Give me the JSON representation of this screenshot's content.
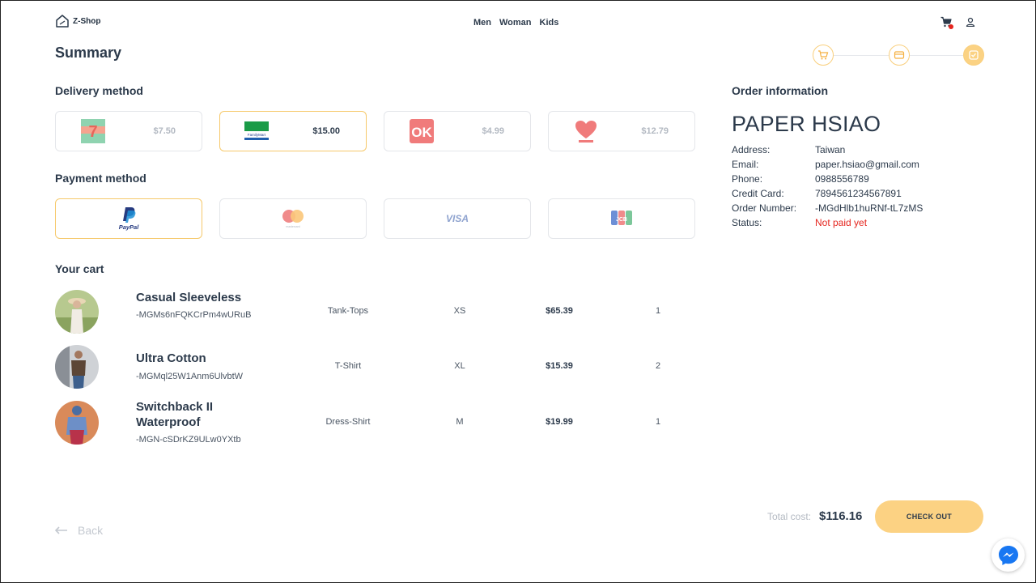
{
  "header": {
    "logo_text": "Z-Shop",
    "nav": [
      "Men",
      "Woman",
      "Kids"
    ]
  },
  "page_title": "Summary",
  "delivery": {
    "title": "Delivery method",
    "options": [
      {
        "name": "7-Eleven",
        "price": "$7.50",
        "selected": false
      },
      {
        "name": "FamilyMart",
        "price": "$15.00",
        "selected": true
      },
      {
        "name": "OK",
        "price": "$4.99",
        "selected": false
      },
      {
        "name": "Hi-Life",
        "price": "$12.79",
        "selected": false
      }
    ]
  },
  "payment": {
    "title": "Payment method",
    "options": [
      {
        "name": "PayPal",
        "selected": true
      },
      {
        "name": "mastercard",
        "selected": false
      },
      {
        "name": "VISA",
        "selected": false
      },
      {
        "name": "JCB",
        "selected": false
      }
    ]
  },
  "cart": {
    "title": "Your cart",
    "items": [
      {
        "name": "Casual Sleeveless",
        "id": "-MGMs6nFQKCrPm4wURuB",
        "category": "Tank-Tops",
        "size": "XS",
        "price": "$65.39",
        "qty": "1"
      },
      {
        "name": "Ultra Cotton",
        "id": "-MGMql25W1Anm6UlvbtW",
        "category": "T-Shirt",
        "size": "XL",
        "price": "$15.39",
        "qty": "2"
      },
      {
        "name": "Switchback II Waterproof",
        "id": "-MGN-cSDrKZ9ULw0YXtb",
        "category": "Dress-Shirt",
        "size": "M",
        "price": "$19.99",
        "qty": "1"
      }
    ]
  },
  "order_info": {
    "title": "Order information",
    "customer_name": "PAPER HSIAO",
    "rows": [
      {
        "label": "Address:",
        "value": "Taiwan"
      },
      {
        "label": "Email:",
        "value": "paper.hsiao@gmail.com"
      },
      {
        "label": "Phone:",
        "value": "0988556789"
      },
      {
        "label": "Credit Card:",
        "value": "7894561234567891"
      },
      {
        "label": "Order Number:",
        "value": "-MGdHlb1huRNf-tL7zMS"
      },
      {
        "label": "Status:",
        "value": "Not paid yet"
      }
    ]
  },
  "footer": {
    "back_label": "Back",
    "total_label": "Total cost:",
    "total_value": "$116.16",
    "checkout_label": "CHECK OUT"
  },
  "colors": {
    "accent": "#fcd283",
    "status_unpaid": "#e5261f"
  }
}
